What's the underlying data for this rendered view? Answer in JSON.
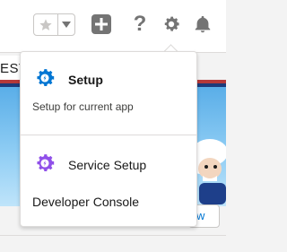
{
  "header": {
    "favorites_star": "star-icon",
    "favorites_caret": "caret-down-icon",
    "add_icon": "plus-icon",
    "help_label": "?",
    "settings_icon": "gear-icon",
    "notifications_icon": "bell-icon"
  },
  "background": {
    "tab_fragment": "EST",
    "right_button_fragment": "w"
  },
  "setup_menu": {
    "items": [
      {
        "label": "Setup",
        "sublabel": "Setup for current app",
        "icon": "setup-gear-icon",
        "icon_color": "#0176d3"
      },
      {
        "label": "Service Setup",
        "icon": "service-setup-gear-icon",
        "icon_color": "#9050e9"
      },
      {
        "label": "Developer Console"
      }
    ]
  },
  "colors": {
    "accent_blue": "#0176d3",
    "service_purple": "#9050e9",
    "icon_gray": "#747474"
  }
}
